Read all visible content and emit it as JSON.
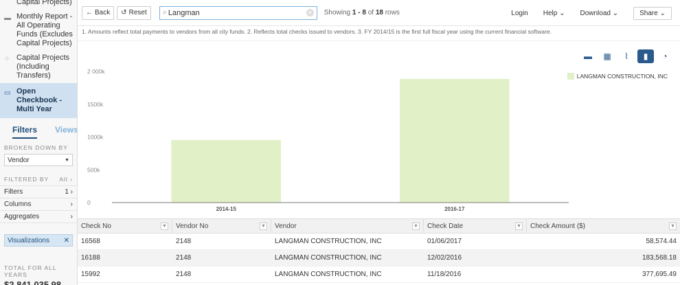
{
  "sidebar": {
    "nav_items": [
      {
        "label": "Capital Projects)",
        "icon": ""
      },
      {
        "label": "Monthly Report - All Operating Funds (Excludes Capital Projects)",
        "icon": "report-icon"
      },
      {
        "label": "Capital Projects (Including Transfers)",
        "icon": "scatter-icon"
      },
      {
        "label": "Open Checkbook - Multi Year",
        "icon": "checkbook-icon"
      }
    ],
    "tabs": {
      "filters": "Filters",
      "views": "Views"
    },
    "broken_down_by_label": "BROKEN DOWN BY",
    "broken_down_by_value": "Vendor",
    "filtered_by_label": "FILTERED BY",
    "filtered_by_all": "All",
    "filters_row": {
      "label": "Filters",
      "count": "1"
    },
    "columns_row": {
      "label": "Columns"
    },
    "aggregates_row": {
      "label": "Aggregates"
    },
    "visualizations_label": "Visualizations",
    "total_label": "TOTAL FOR ALL YEARS",
    "total_value": "$2,841,035.98"
  },
  "toolbar": {
    "back_label": "Back",
    "reset_label": "Reset",
    "search_value": "Langman",
    "showing_prefix": "Showing",
    "showing_range": "1 - 8",
    "showing_of": "of",
    "showing_total": "18",
    "showing_suffix": "rows",
    "login": "Login",
    "help": "Help",
    "download": "Download",
    "share": "Share"
  },
  "footnote": "1. Amounts reflect total payments to vendors from all city funds. 2. Reflects total checks issued to vendors. 3. FY 2014/15 is the first full fiscal year using the current financial software.",
  "chart_data": {
    "type": "bar",
    "categories": [
      "2014-15",
      "2016-17"
    ],
    "series": [
      {
        "name": "LANGMAN CONSTRUCTION, INC",
        "values": [
          955,
          1886
        ],
        "color": "#e2f0c8"
      }
    ],
    "yticks": [
      "0",
      "500k",
      "1000k",
      "1500k",
      "2 000k"
    ],
    "ylim": [
      0,
      2000
    ]
  },
  "table": {
    "columns": [
      "Check No",
      "Vendor No",
      "Vendor",
      "Check Date",
      "Check Amount ($)"
    ],
    "rows": [
      [
        "16568",
        "2148",
        "LANGMAN CONSTRUCTION, INC",
        "01/06/2017",
        "58,574.44"
      ],
      [
        "16188",
        "2148",
        "LANGMAN CONSTRUCTION, INC",
        "12/02/2016",
        "183,568.18"
      ],
      [
        "15992",
        "2148",
        "LANGMAN CONSTRUCTION, INC",
        "11/18/2016",
        "377,695.49"
      ]
    ]
  }
}
